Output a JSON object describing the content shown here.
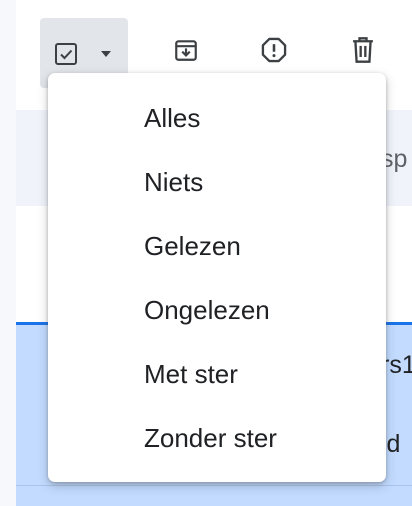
{
  "toolbar": {
    "select_control": {
      "checkbox_icon": "checkbox-checked-icon",
      "caret_icon": "caret-down-icon"
    },
    "buttons": [
      {
        "icon": "archive-icon"
      },
      {
        "icon": "report-spam-icon"
      },
      {
        "icon": "trash-icon"
      }
    ]
  },
  "tabs": {
    "partial_label": "sp"
  },
  "mail_rows": [
    {
      "partial_text": "rs1"
    },
    {
      "partial_text": "id"
    }
  ],
  "select_menu": {
    "items": [
      {
        "label": "Alles"
      },
      {
        "label": "Niets"
      },
      {
        "label": "Gelezen"
      },
      {
        "label": "Ongelezen"
      },
      {
        "label": "Met ster"
      },
      {
        "label": "Zonder ster"
      }
    ]
  },
  "colors": {
    "selected_row": "#c2dbff",
    "select_control_bg": "#e2e5ea",
    "tabs_band": "#f0f4fa",
    "accent": "#1a73e8"
  }
}
